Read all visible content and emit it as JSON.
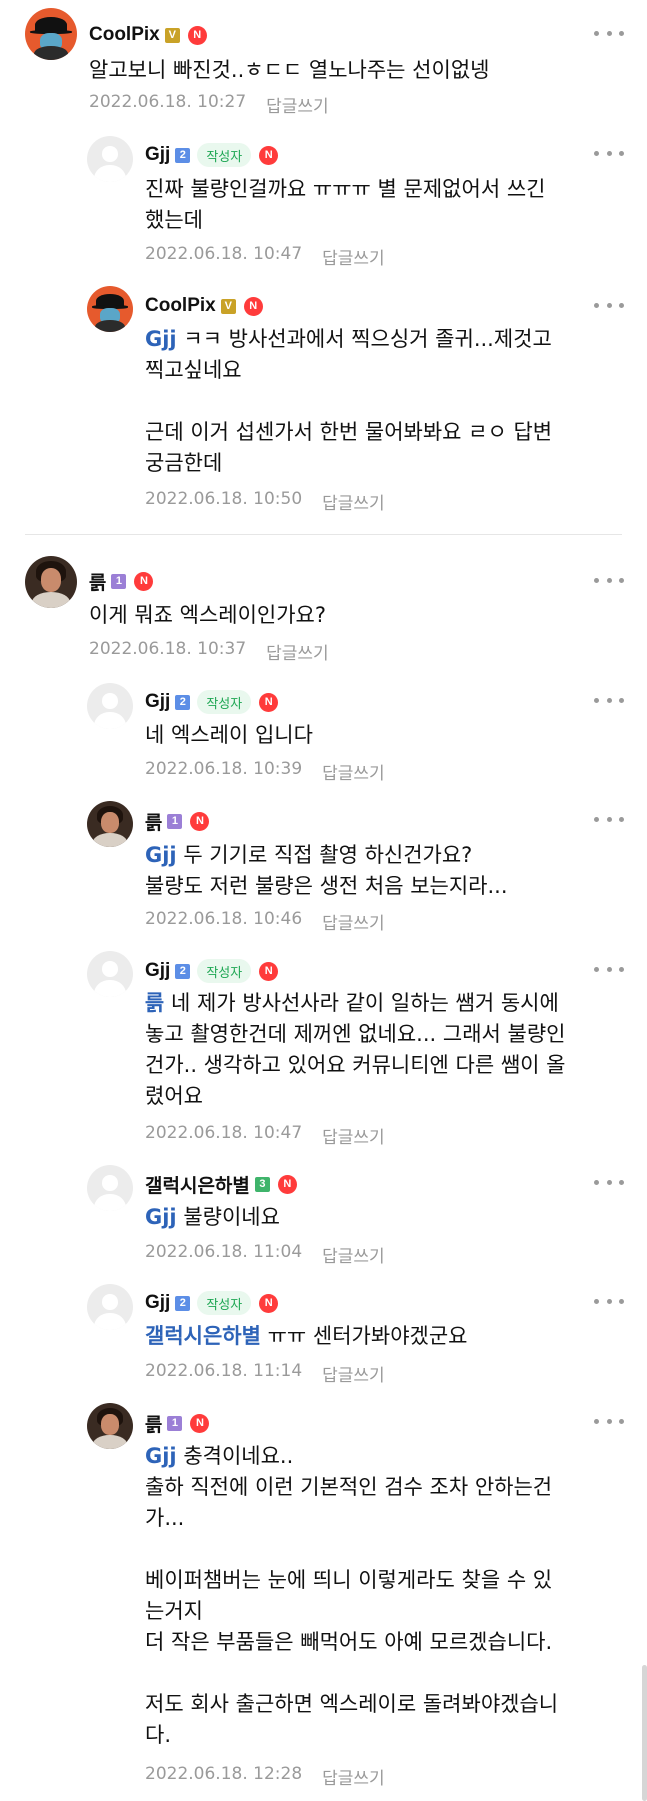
{
  "comments": [
    {
      "nick": "CoolPix",
      "level": "V",
      "author_badge": "",
      "new": "N",
      "mention": "",
      "text": "알고보니 빠진것..ㅎㄷㄷ 열노나주는 선이없넹",
      "date": "2022.06.18. 10:27",
      "reply_label": "답글쓰기",
      "avatar": "coolpix"
    },
    {
      "nick": "Gjj",
      "level": "2",
      "author_badge": "작성자",
      "new": "N",
      "mention": "",
      "text": "진짜 불량인걸까요 ㅠㅠㅠ 별 문제없어서 쓰긴\n했는데",
      "date": "2022.06.18. 10:47",
      "reply_label": "답글쓰기",
      "avatar": "default"
    },
    {
      "nick": "CoolPix",
      "level": "V",
      "author_badge": "",
      "new": "N",
      "mention": "Gjj",
      "text": " ㅋㅋ 방사선과에서 찍으싱거 졸귀...제것고\n찍고싶네요\n\n근데 이거 섭센가서 한번 물어봐봐요 ㄹㅇ 답변\n궁금한데",
      "date": "2022.06.18. 10:50",
      "reply_label": "답글쓰기",
      "avatar": "coolpix"
    },
    {
      "nick": "륽",
      "level": "1",
      "author_badge": "",
      "new": "N",
      "mention": "",
      "text": "이게 뭐죠 엑스레이인가요?",
      "date": "2022.06.18. 10:37",
      "reply_label": "답글쓰기",
      "avatar": "ruk"
    },
    {
      "nick": "Gjj",
      "level": "2",
      "author_badge": "작성자",
      "new": "N",
      "mention": "",
      "text": "네 엑스레이 입니다",
      "date": "2022.06.18. 10:39",
      "reply_label": "답글쓰기",
      "avatar": "default"
    },
    {
      "nick": "륽",
      "level": "1",
      "author_badge": "",
      "new": "N",
      "mention": "Gjj",
      "text": " 두 기기로 직접 촬영 하신건가요?\n불량도 저런 불량은 생전 처음 보는지라...",
      "date": "2022.06.18. 10:46",
      "reply_label": "답글쓰기",
      "avatar": "ruk"
    },
    {
      "nick": "Gjj",
      "level": "2",
      "author_badge": "작성자",
      "new": "N",
      "mention": "륽",
      "text": " 네 제가 방사선사라 같이 일하는 쌤거 동시에\n놓고 촬영한건데 제꺼엔 없네요... 그래서 불량인\n건가.. 생각하고 있어요 커뮤니티엔 다른 쌤이 올\n렸어요",
      "date": "2022.06.18. 10:47",
      "reply_label": "답글쓰기",
      "avatar": "default"
    },
    {
      "nick": "갤럭시은하별",
      "level": "3",
      "author_badge": "",
      "new": "N",
      "mention": "Gjj",
      "text": " 불량이네요",
      "date": "2022.06.18. 11:04",
      "reply_label": "답글쓰기",
      "avatar": "default"
    },
    {
      "nick": "Gjj",
      "level": "2",
      "author_badge": "작성자",
      "new": "N",
      "mention": "갤럭시은하별",
      "text": " ㅠㅠ 센터가봐야겠군요",
      "date": "2022.06.18. 11:14",
      "reply_label": "답글쓰기",
      "avatar": "default"
    },
    {
      "nick": "륽",
      "level": "1",
      "author_badge": "",
      "new": "N",
      "mention": "Gjj",
      "text": " 충격이네요..\n출하 직전에 이런 기본적인 검수 조차 안하는건\n가...\n\n베이퍼챔버는 눈에 띄니 이렇게라도 찾을 수 있\n는거지\n더 작은 부품들은 빼먹어도 아예 모르겠습니다.\n\n저도 회사 출근하면 엑스레이로 돌려봐야겠습니\n다.",
      "date": "2022.06.18. 12:28",
      "reply_label": "답글쓰기",
      "avatar": "ruk"
    }
  ]
}
